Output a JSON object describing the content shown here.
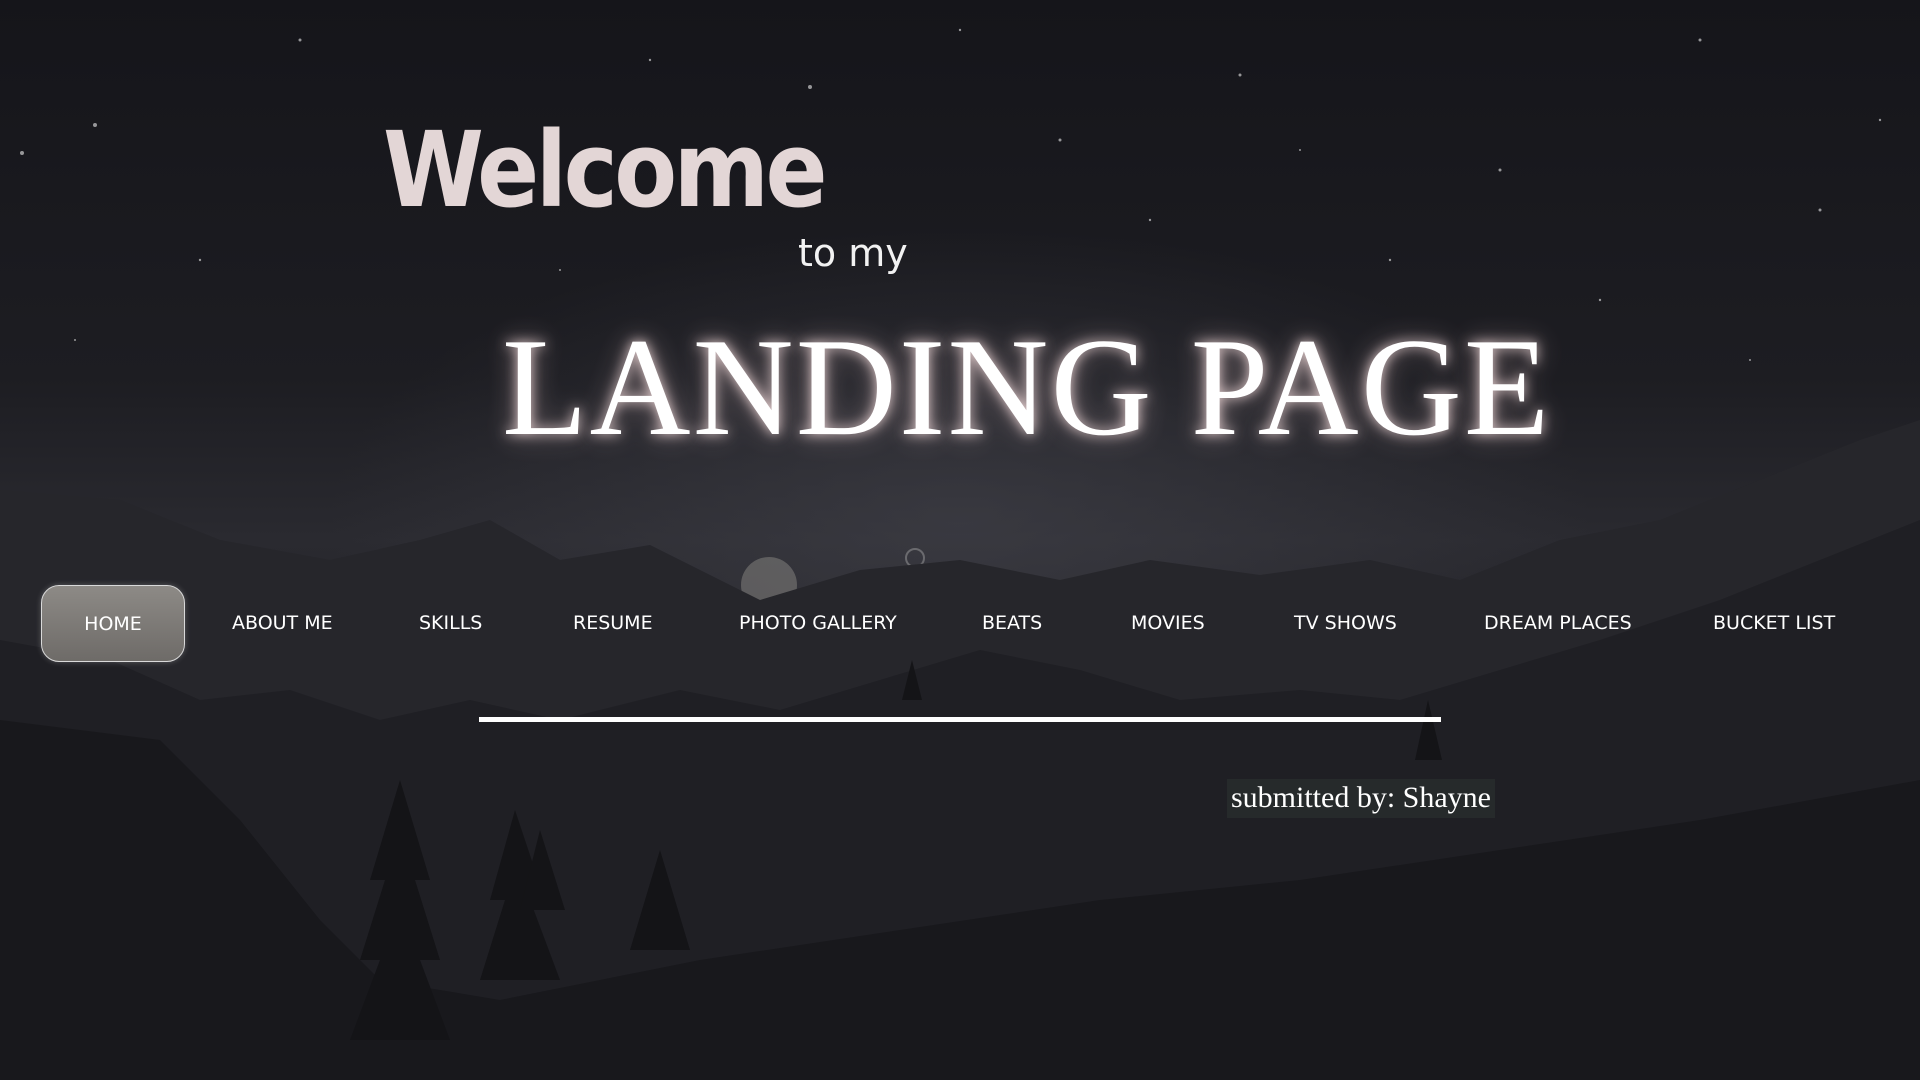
{
  "hero": {
    "welcome": "Welcome",
    "to_my": "to my",
    "title": "LANDING PAGE"
  },
  "nav": {
    "items": [
      {
        "label": "HOME",
        "active": true
      },
      {
        "label": "ABOUT ME",
        "active": false
      },
      {
        "label": "SKILLS",
        "active": false
      },
      {
        "label": "RESUME",
        "active": false
      },
      {
        "label": "PHOTO GALLERY",
        "active": false
      },
      {
        "label": "BEATS",
        "active": false
      },
      {
        "label": "MOVIES",
        "active": false
      },
      {
        "label": "TV SHOWS",
        "active": false
      },
      {
        "label": "DREAM PLACES",
        "active": false
      },
      {
        "label": "BUCKET LIST",
        "active": false
      }
    ]
  },
  "footer": {
    "submitted": "submitted by: Shayne"
  },
  "colors": {
    "welcome": "#e3d6d6",
    "text": "#ffffff",
    "active_button": "#7d7a77",
    "background": "#1c1c21"
  }
}
